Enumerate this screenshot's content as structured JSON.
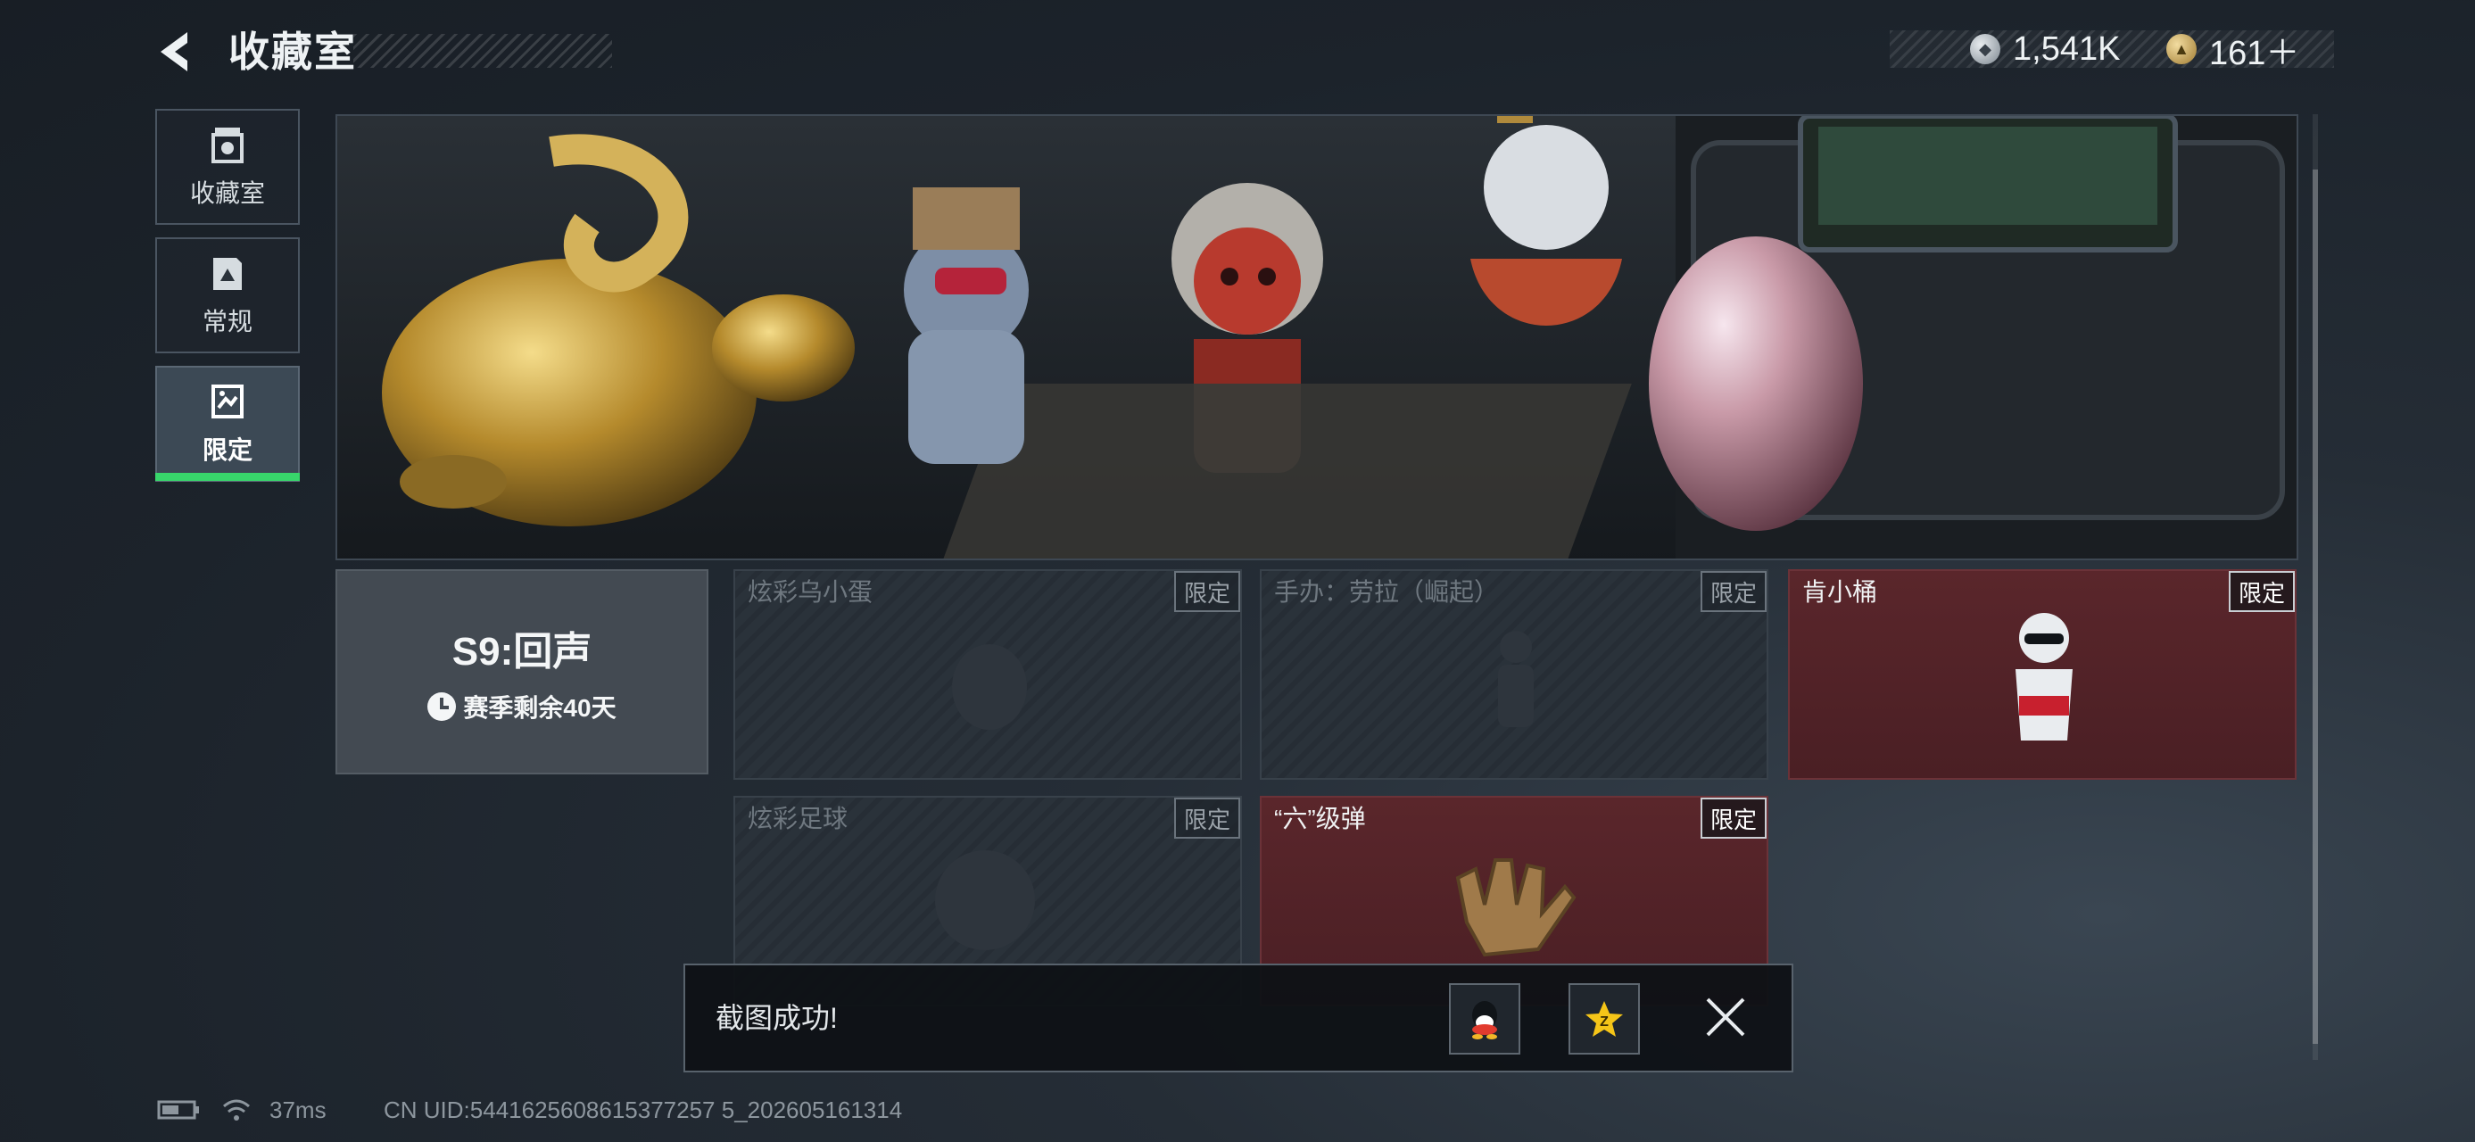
{
  "header": {
    "title": "收藏室",
    "currencies": [
      {
        "name": "silver-coin",
        "value": "1,541K"
      },
      {
        "name": "gold-coin",
        "value": "161＋"
      }
    ]
  },
  "nav": {
    "items": [
      {
        "label": "收藏室",
        "icon": "collection-icon",
        "active": false
      },
      {
        "label": "常规",
        "icon": "regular-icon",
        "active": false
      },
      {
        "label": "限定",
        "icon": "limited-icon",
        "active": true
      }
    ],
    "accent": "#38d66b"
  },
  "season": {
    "title": "S9:回声",
    "remaining": "赛季剩余40天"
  },
  "cards": [
    {
      "name": "炫彩乌小蛋",
      "badge": "限定",
      "owned": false
    },
    {
      "name": "手办：劳拉（崛起）",
      "badge": "限定",
      "owned": false
    },
    {
      "name": "肯小桶",
      "badge": "限定",
      "owned": true
    },
    {
      "name": "炫彩足球",
      "badge": "限定",
      "owned": false
    },
    {
      "name": "“六”级弹",
      "badge": "限定",
      "owned": true
    }
  ],
  "toast": {
    "message": "截图成功!",
    "share_targets": [
      "qq-icon",
      "qzone-icon"
    ]
  },
  "status": {
    "ping": "37ms",
    "uid": "CN UID:5441625608615377257 5_202605161314"
  }
}
